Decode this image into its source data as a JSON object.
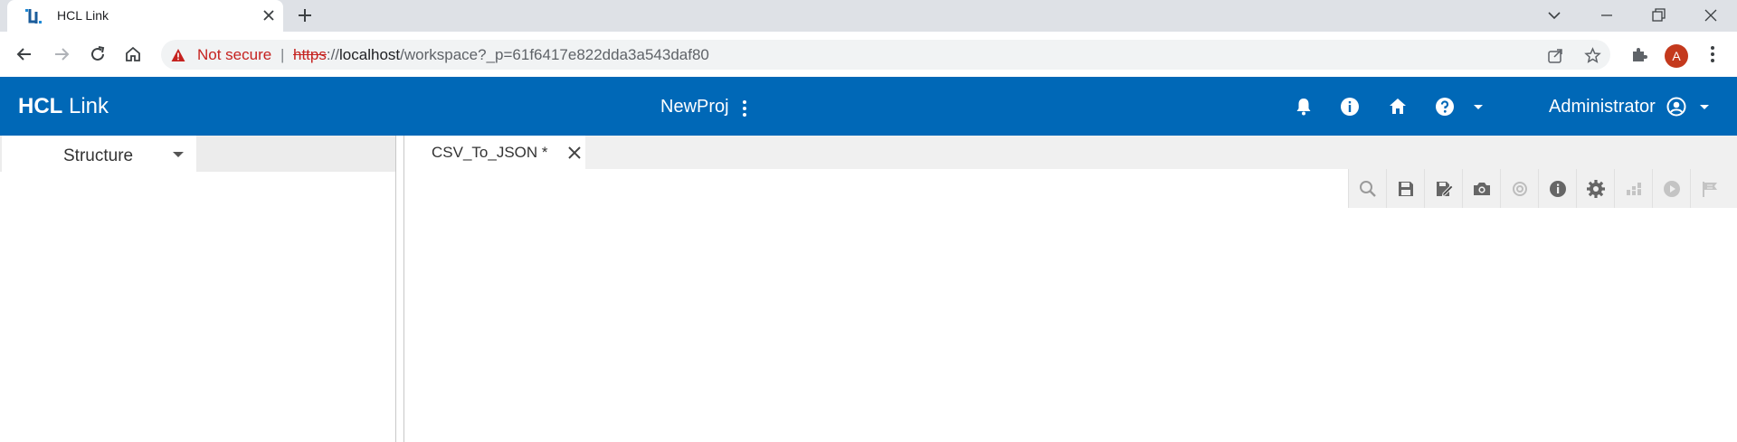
{
  "browser": {
    "tab_title": "HCL Link",
    "security_label": "Not secure",
    "separator": "|",
    "url_scheme": "https",
    "url_sep": "://",
    "url_host": "localhost",
    "url_path": "/workspace?_p=61f6417e822dda3a543daf80",
    "profile_initial": "A"
  },
  "header": {
    "brand_bold": "HCL",
    "brand_rest": " Link",
    "project_name": "NewProj",
    "user_name": "Administrator"
  },
  "left_panel": {
    "view_label": "Structure"
  },
  "editor": {
    "tab_label": "CSV_To_JSON *"
  },
  "colors": {
    "header_bg": "#0068b7",
    "security_red": "#c5221f",
    "avatar_bg": "#c4391d"
  }
}
